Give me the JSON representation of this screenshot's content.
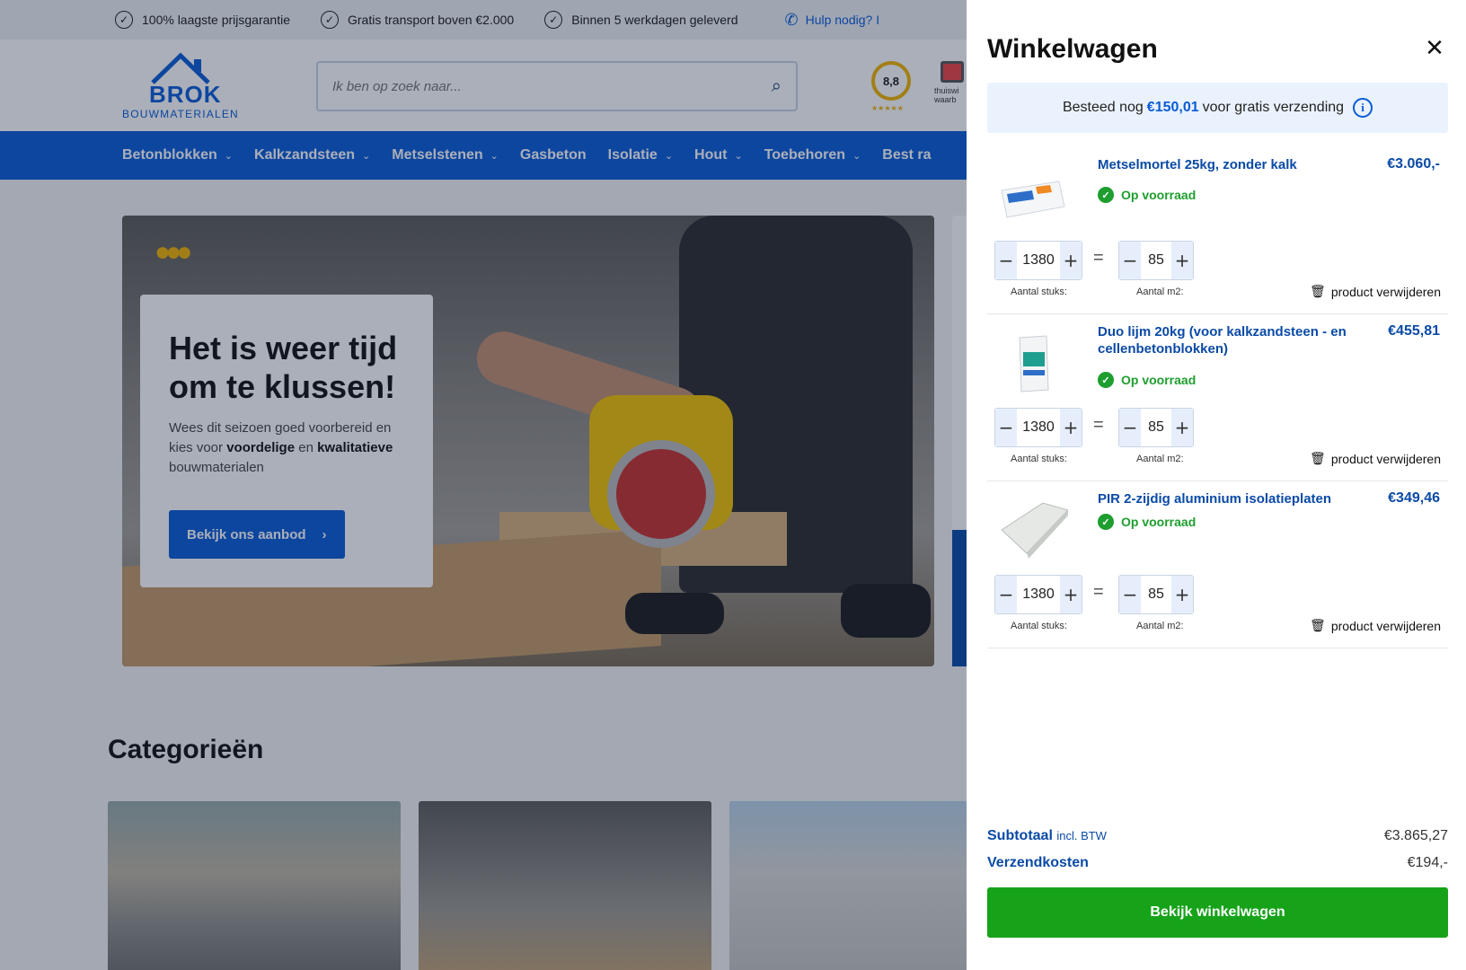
{
  "usp": [
    "100% laagste prijsgarantie",
    "Gratis transport boven €2.000",
    "Binnen 5 werkdagen geleverd"
  ],
  "help_label": "Hulp nodig? I",
  "logo": {
    "name": "BROK",
    "sub": "BOUWMATERIALEN"
  },
  "search": {
    "placeholder": "Ik ben op zoek naar..."
  },
  "rating": {
    "score": "8,8",
    "stars": "★★★★★"
  },
  "thuiswinkel": {
    "line1": "thuiswi",
    "line2": "waarb"
  },
  "nav": [
    "Betonblokken",
    "Kalkzandsteen",
    "Metselstenen",
    "Gasbeton",
    "Isolatie",
    "Hout",
    "Toebehoren",
    "Best ra"
  ],
  "hero": {
    "title": "Het is weer tijd om te klussen!",
    "text_pre": "Wees dit seizoen goed voorbereid en kies voor ",
    "text_b1": "voordelige",
    "text_mid": " en ",
    "text_b2": "kwalitatieve",
    "text_post": " bouwmaterialen",
    "button": "Bekijk ons aanbod"
  },
  "categories_title": "Categorieën",
  "cart": {
    "title": "Winkelwagen",
    "ship_pre": "Besteed nog",
    "ship_amount": "€150,01",
    "ship_post": "voor gratis verzending",
    "items": [
      {
        "name": "Metselmortel 25kg, zonder kalk",
        "price": "€3.060,-",
        "stock": "Op voorraad",
        "pieces": "1380",
        "m2": "85",
        "pieces_label": "Aantal stuks:",
        "m2_label": "Aantal m2:",
        "remove": "product verwijderen"
      },
      {
        "name": "Duo lijm 20kg (voor kalkzandsteen - en cellenbetonblokken)",
        "price": "€455,81",
        "stock": "Op voorraad",
        "pieces": "1380",
        "m2": "85",
        "pieces_label": "Aantal stuks:",
        "m2_label": "Aantal m2:",
        "remove": "product verwijderen"
      },
      {
        "name": "PIR 2-zijdig aluminium isolatieplaten",
        "price": "€349,46",
        "stock": "Op voorraad",
        "pieces": "1380",
        "m2": "85",
        "pieces_label": "Aantal stuks:",
        "m2_label": "Aantal m2:",
        "remove": "product verwijderen"
      }
    ],
    "subtotal_label": "Subtotaal",
    "subtotal_note": "incl. BTW",
    "subtotal": "€3.865,27",
    "shipping_label": "Verzendkosten",
    "shipping": "€194,-",
    "checkout": "Bekijk winkelwagen"
  },
  "colors": {
    "brand_blue": "#0a5bd6",
    "checkout_green": "#16a31a",
    "stock_green": "#1e9e2f"
  }
}
